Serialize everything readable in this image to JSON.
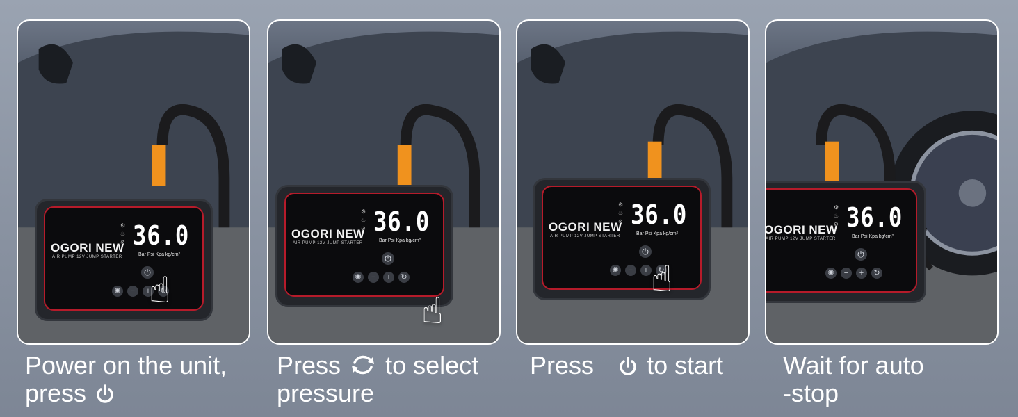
{
  "steps": [
    {
      "caption_line1": "Power on the unit,",
      "caption_line2": "press",
      "caption_icon": "power-icon"
    },
    {
      "caption_before": "Press",
      "caption_after": "to select",
      "caption_line2": "pressure",
      "caption_icon": "refresh-icon"
    },
    {
      "caption_before": "Press",
      "caption_after": "to start",
      "caption_icon": "power-icon"
    },
    {
      "caption_line1": "Wait for auto",
      "caption_line2": "-stop"
    }
  ],
  "device": {
    "brand": "OGORI NEW",
    "subbrand": "AIR PUMP 12V JUMP STARTER",
    "reading": "36.0",
    "units": "Bar Psi Kpa kg/cm²"
  },
  "colors": {
    "accent_red": "#b61b2a",
    "nozzle_orange": "#f0921e",
    "caption_text": "#ffffff"
  }
}
